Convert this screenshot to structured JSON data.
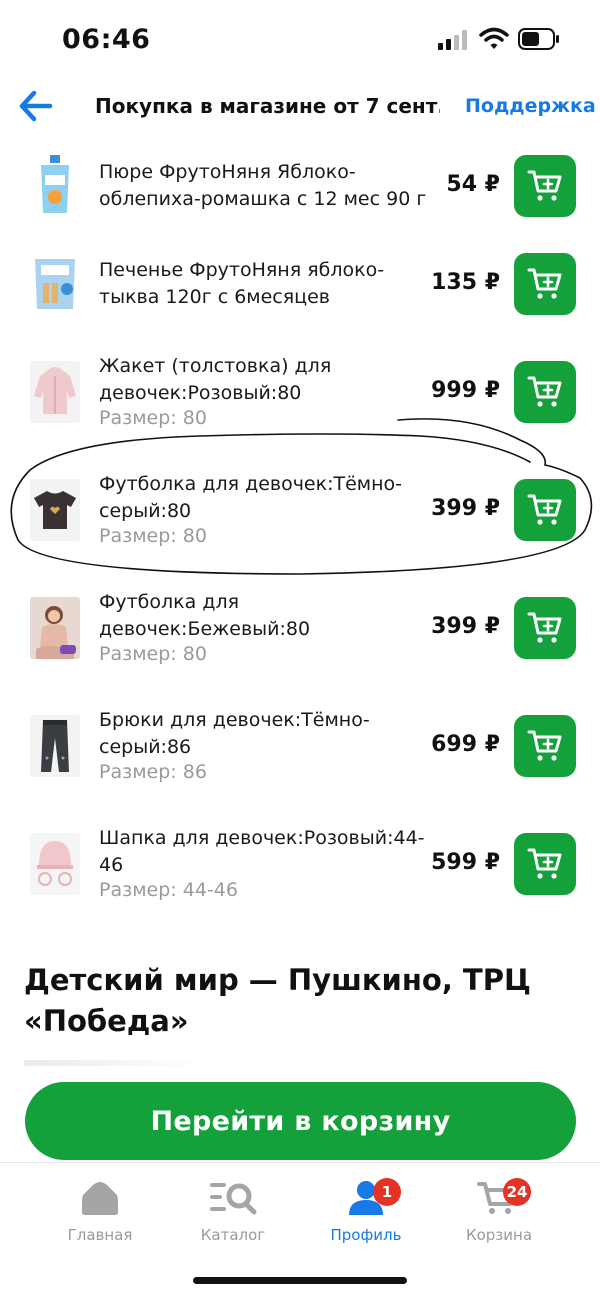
{
  "status": {
    "time": "06:46"
  },
  "header": {
    "back_icon": "arrow-left-icon",
    "title": "Покупка в магазине от 7 сент...",
    "support": "Поддержка"
  },
  "items": [
    {
      "name": "Пюре ФрутоНяня Яблоко-облепиха-ромашка с 12 мес 90 г",
      "size": "",
      "price": "54 ₽"
    },
    {
      "name": "Печенье ФрутоНяня яблоко-тыква 120г с 6месяцев",
      "size": "",
      "price": "135 ₽"
    },
    {
      "name": "Жакет (толстовка) для девочек:Розовый:80",
      "size": "Размер: 80",
      "price": "999 ₽"
    },
    {
      "name": "Футболка для девочек:Тёмно-серый:80",
      "size": "Размер: 80",
      "price": "399 ₽"
    },
    {
      "name": "Футболка для девочек:Бежевый:80",
      "size": "Размер: 80",
      "price": "399 ₽"
    },
    {
      "name": "Брюки для девочек:Тёмно-серый:86",
      "size": "Размер: 86",
      "price": "699 ₽"
    },
    {
      "name": "Шапка для девочек:Розовый:44-46",
      "size": "Размер: 44-46",
      "price": "599 ₽"
    }
  ],
  "store": {
    "name": "Детский мир — Пушкино, ТРЦ «Победа»"
  },
  "cart_button": {
    "label": "Перейти в корзину"
  },
  "tabbar": {
    "home": {
      "label": "Главная",
      "icon": "home-icon"
    },
    "catalog": {
      "label": "Каталог",
      "icon": "catalog-search-icon"
    },
    "profile": {
      "label": "Профиль",
      "icon": "profile-icon",
      "badge": "1"
    },
    "cart": {
      "label": "Корзина",
      "icon": "cart-icon",
      "badge": "24"
    }
  },
  "colors": {
    "accent_green": "#14a13c",
    "link_blue": "#1779e6",
    "badge_red": "#e53226"
  }
}
